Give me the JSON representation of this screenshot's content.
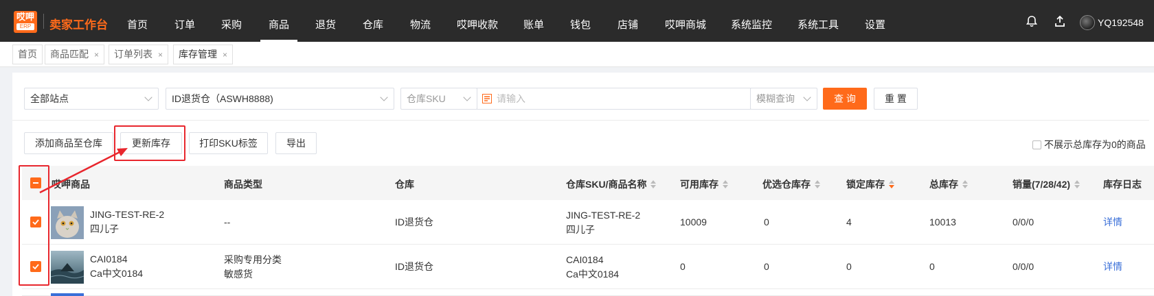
{
  "app": {
    "logo_line1": "哎呷",
    "logo_line2": "ERP",
    "brand": "卖家工作台",
    "username": "YQ192548"
  },
  "nav": [
    {
      "label": "首页"
    },
    {
      "label": "订单"
    },
    {
      "label": "采购"
    },
    {
      "label": "商品"
    },
    {
      "label": "退货"
    },
    {
      "label": "仓库"
    },
    {
      "label": "物流"
    },
    {
      "label": "哎呷收款"
    },
    {
      "label": "账单"
    },
    {
      "label": "钱包"
    },
    {
      "label": "店铺"
    },
    {
      "label": "哎呷商城"
    },
    {
      "label": "系统监控"
    },
    {
      "label": "系统工具"
    },
    {
      "label": "设置"
    }
  ],
  "nav_active": "商品",
  "tabs": [
    {
      "label": "首页",
      "closable": false
    },
    {
      "label": "商品匹配",
      "closable": true
    },
    {
      "label": "订单列表",
      "closable": true
    },
    {
      "label": "库存管理",
      "closable": true,
      "active": true
    }
  ],
  "filters": {
    "site": "全部站点",
    "warehouse": "ID退货仓（ASWH8888)",
    "sku_type": "仓库SKU",
    "search_placeholder": "请输入",
    "match_mode": "模糊查询",
    "query_btn": "查 询",
    "reset_btn": "重 置"
  },
  "actions": {
    "add": "添加商品至仓库",
    "update": "更新库存",
    "print": "打印SKU标签",
    "export": "导出",
    "hide_zero": "不展示总库存为0的商品"
  },
  "table": {
    "headers": {
      "product": "哎呷商品",
      "type": "商品类型",
      "warehouse": "仓库",
      "sku": "仓库SKU/商品名称",
      "available": "可用库存",
      "preferred": "优选仓库存",
      "locked": "锁定库存",
      "total": "总库存",
      "sales": "销量(7/28/42)",
      "log": "库存日志"
    },
    "rows": [
      {
        "product_sku": "JING-TEST-RE-2",
        "product_name": "四儿子",
        "type1": "--",
        "type2": "",
        "warehouse": "ID退货仓",
        "sku": "JING-TEST-RE-2",
        "name": "四儿子",
        "available": "10009",
        "preferred": "0",
        "locked": "4",
        "total": "10013",
        "sales": "0/0/0",
        "log": "详情",
        "checked": true
      },
      {
        "product_sku": "CAI0184",
        "product_name": "Ca中文0184",
        "type1": "采购专用分类",
        "type2": "敏感货",
        "warehouse": "ID退货仓",
        "sku": "CAI0184",
        "name": "Ca中文0184",
        "available": "0",
        "preferred": "0",
        "locked": "0",
        "total": "0",
        "sales": "0/0/0",
        "log": "详情",
        "checked": true
      }
    ]
  },
  "colors": {
    "accent": "#ff6a1a",
    "topbar": "#2b2b2b",
    "link": "#3a6fd8",
    "annotation": "#e8262d"
  }
}
